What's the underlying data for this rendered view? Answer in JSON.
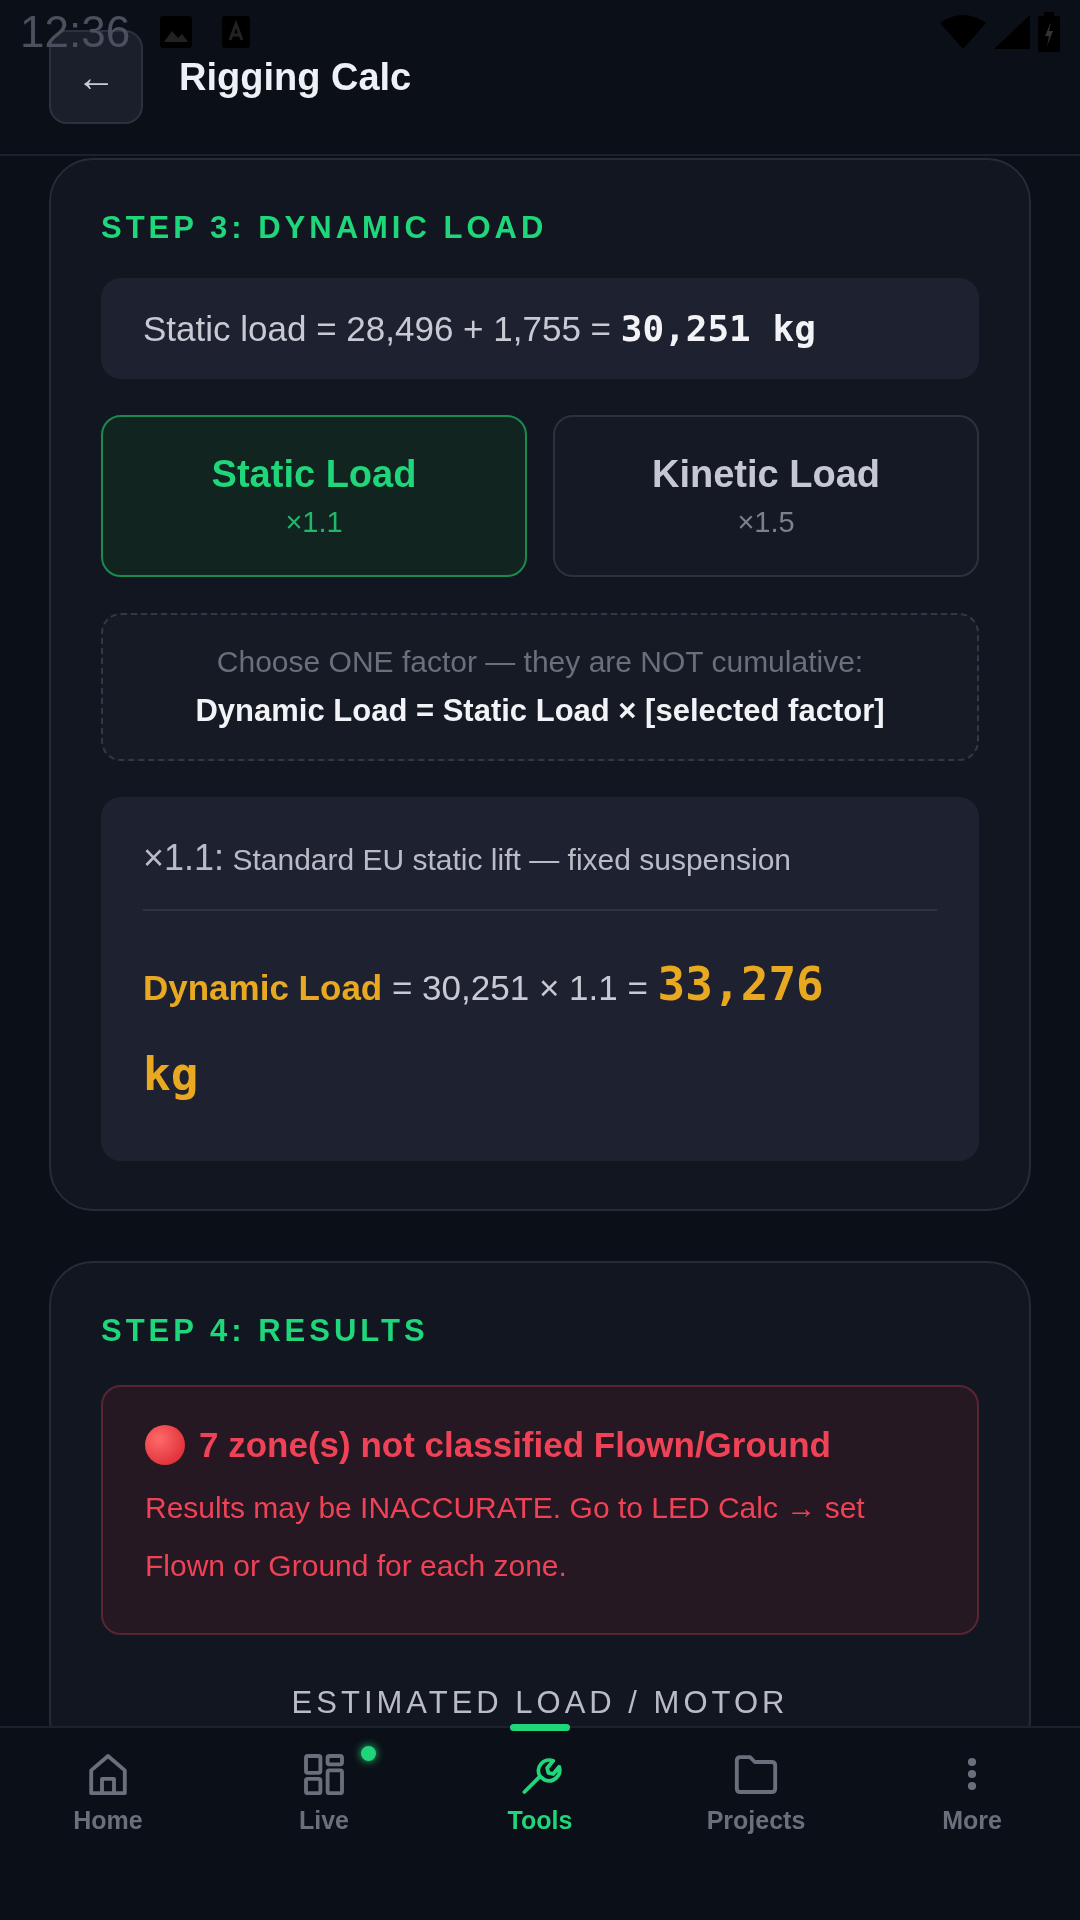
{
  "status_bar": {
    "time": "12:36"
  },
  "header": {
    "back_label": "←",
    "title": "Rigging Calc"
  },
  "step3": {
    "heading": "STEP 3: DYNAMIC LOAD",
    "static_line": {
      "expression": "Static load = 28,496 + 1,755 = ",
      "value": "30,251 kg"
    },
    "factors": [
      {
        "title": "Static Load",
        "multiplier": "×1.1",
        "selected": true
      },
      {
        "title": "Kinetic Load",
        "multiplier": "×1.5",
        "selected": false
      }
    ],
    "note": {
      "line1": "Choose ONE factor — they are NOT cumulative:",
      "line2": "Dynamic Load = Static Load × [selected factor]"
    },
    "result": {
      "factor": "×1.1:",
      "description": "Standard EU static lift — fixed suspension",
      "label": "Dynamic Load",
      "expression": " = 30,251 × 1.1 = ",
      "value": "33,276 kg"
    }
  },
  "step4": {
    "heading": "STEP 4: RESULTS",
    "alert": {
      "title": "7 zone(s) not classified Flown/Ground",
      "message": "Results may be INACCURATE. Go to LED Calc → set Flown or Ground for each zone."
    },
    "subheading": "ESTIMATED LOAD / MOTOR"
  },
  "nav": [
    {
      "kind": "home",
      "label": "Home",
      "selected": false,
      "dot": false
    },
    {
      "kind": "live",
      "label": "Live",
      "selected": false,
      "dot": true
    },
    {
      "kind": "tools",
      "label": "Tools",
      "selected": true,
      "dot": false
    },
    {
      "kind": "projects",
      "label": "Projects",
      "selected": false,
      "dot": false
    },
    {
      "kind": "more",
      "label": "More",
      "selected": false,
      "dot": false
    }
  ]
}
